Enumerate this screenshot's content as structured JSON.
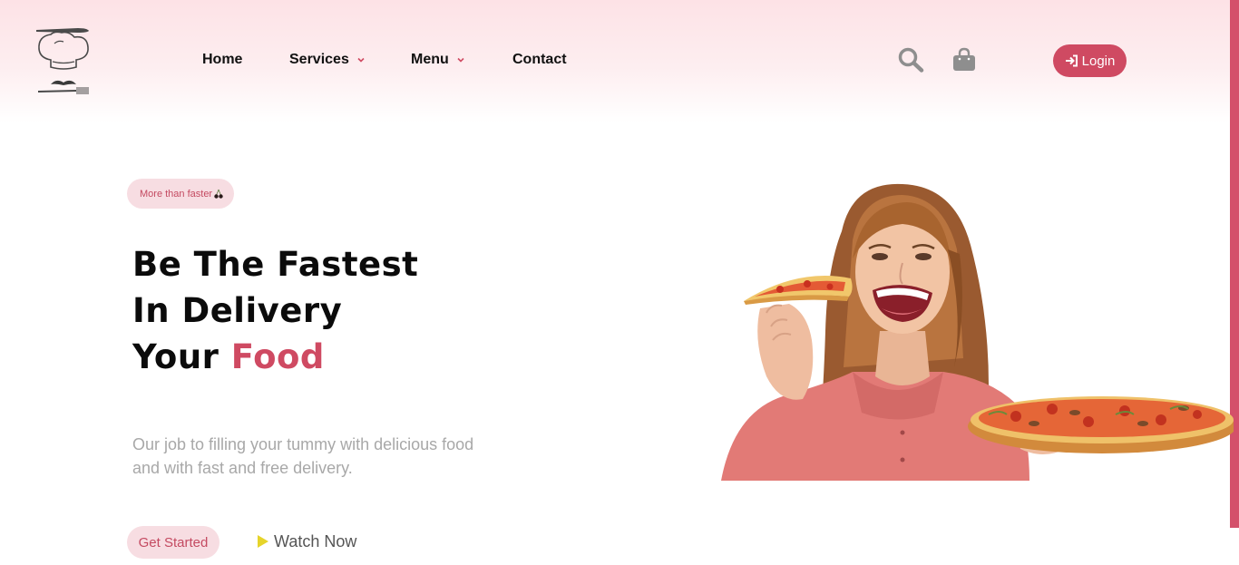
{
  "brand": {
    "accent": "#cf4a62",
    "accent_light": "#f7dde2"
  },
  "logo": {
    "icon": "chef-hat-logo-icon"
  },
  "nav": {
    "items": [
      {
        "label": "Home",
        "has_dropdown": false
      },
      {
        "label": "Services",
        "has_dropdown": true
      },
      {
        "label": "Menu",
        "has_dropdown": true
      },
      {
        "label": "Contact",
        "has_dropdown": false
      }
    ]
  },
  "header_actions": {
    "search_icon": "search-icon",
    "bag_icon": "shopping-bag-icon",
    "login_label": "Login",
    "login_icon": "sign-in-icon"
  },
  "hero": {
    "badge": "More than faster",
    "badge_icon": "cherry-icon",
    "headline_line1": "Be The Fastest",
    "headline_line2": "In Delivery",
    "headline_line3_prefix": "Your ",
    "headline_line3_accent": "Food",
    "description": "Our job to filling your tummy with delicious food and with fast and free delivery.",
    "cta_primary": "Get Started",
    "cta_secondary": "Watch Now",
    "cta_secondary_icon": "play-icon",
    "image": "woman-eating-pizza-illustration"
  }
}
